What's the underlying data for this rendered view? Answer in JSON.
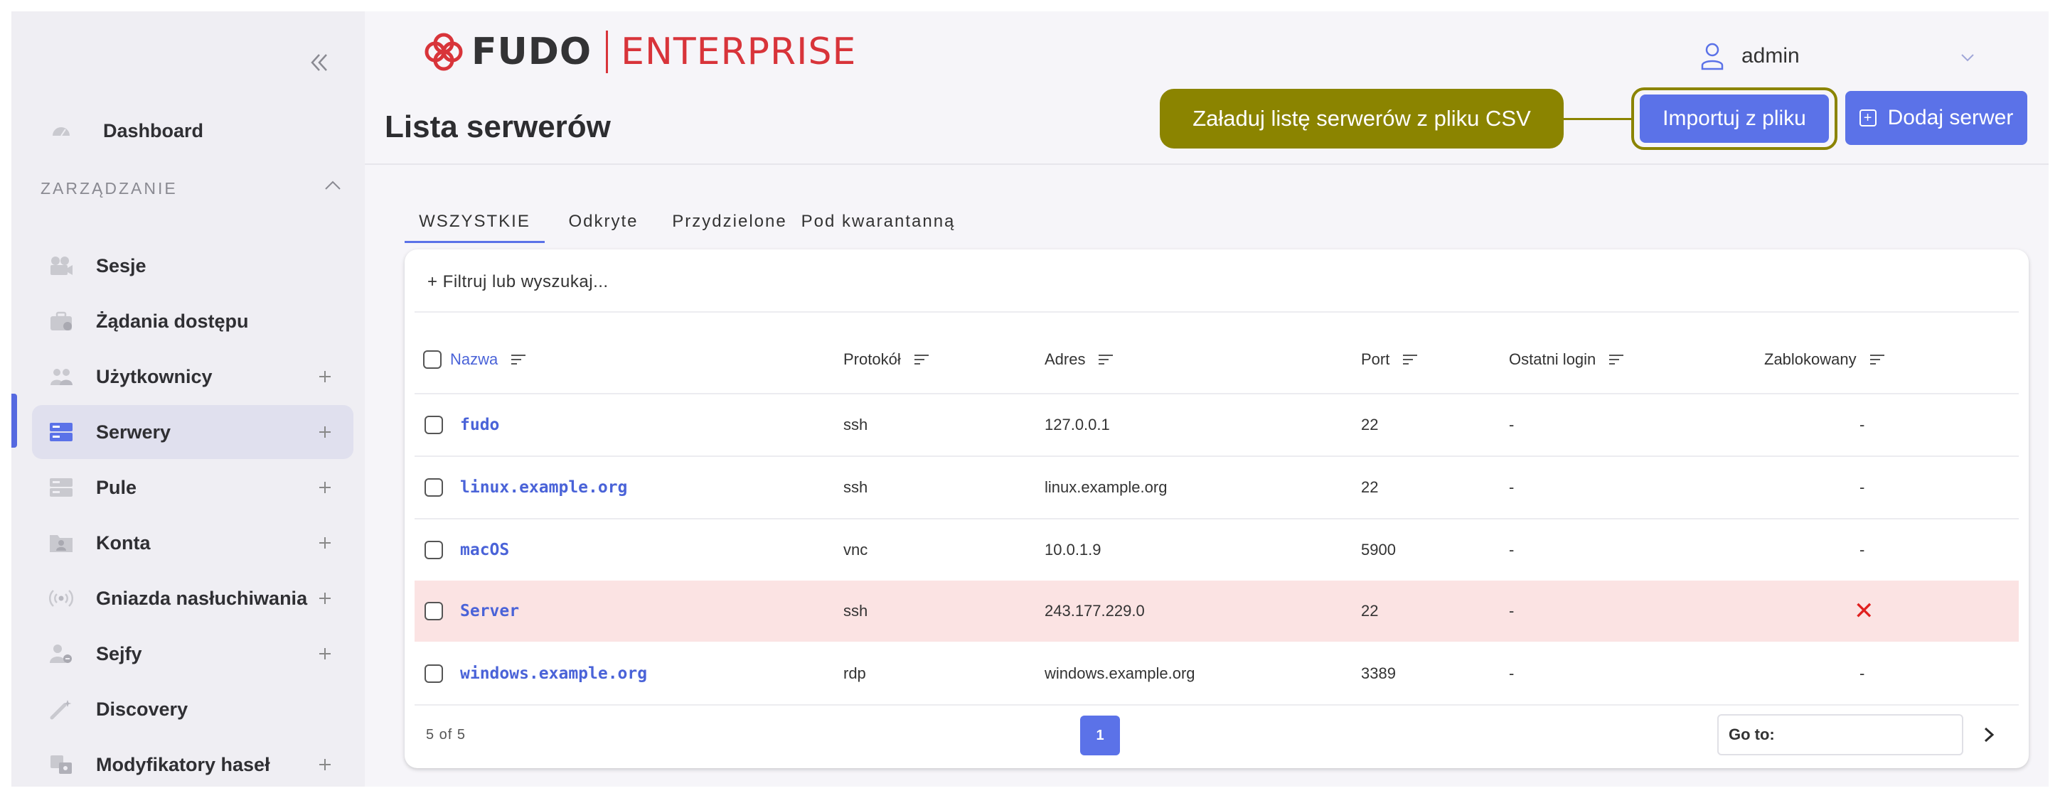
{
  "sidebar": {
    "collapse_icon": "double-chevron-left-icon",
    "dashboard": "Dashboard",
    "section_label": "ZARZĄDZANIE",
    "items": [
      {
        "label": "Sesje",
        "icon": "camera-icon",
        "has_plus": false
      },
      {
        "label": "Żądania dostępu",
        "icon": "briefcase-icon",
        "has_plus": false
      },
      {
        "label": "Użytkownicy",
        "icon": "users-icon",
        "has_plus": true
      },
      {
        "label": "Serwery",
        "icon": "server-icon",
        "has_plus": true,
        "active": true
      },
      {
        "label": "Pule",
        "icon": "pool-icon",
        "has_plus": true
      },
      {
        "label": "Konta",
        "icon": "account-folder-icon",
        "has_plus": true
      },
      {
        "label": "Gniazda nasłuchiwania",
        "icon": "broadcast-icon",
        "has_plus": true
      },
      {
        "label": "Sejfy",
        "icon": "safe-user-icon",
        "has_plus": true
      },
      {
        "label": "Discovery",
        "icon": "wand-icon",
        "has_plus": false
      },
      {
        "label": "Modyfikatory haseł",
        "icon": "password-modifier-icon",
        "has_plus": true
      }
    ]
  },
  "header": {
    "logo_fudo": "FUDO",
    "logo_enterprise": "ENTERPRISE",
    "user_name": "admin",
    "page_title": "Lista serwerów",
    "tooltip": "Załaduj listę serwerów z pliku CSV",
    "import_button": "Importuj z pliku",
    "add_button": "Dodaj serwer"
  },
  "tabs": [
    "WSZYSTKIE",
    "Odkryte",
    "Przydzielone",
    "Pod kwarantanną"
  ],
  "table": {
    "filter_placeholder": "+ Filtruj lub wyszukaj...",
    "columns": [
      "Nazwa",
      "Protokół",
      "Adres",
      "Port",
      "Ostatni login",
      "Zablokowany"
    ],
    "rows": [
      {
        "name": "fudo",
        "protocol": "ssh",
        "address": "127.0.0.1",
        "port": "22",
        "last_login": "-",
        "blocked": "-"
      },
      {
        "name": "linux.example.org",
        "protocol": "ssh",
        "address": "linux.example.org",
        "port": "22",
        "last_login": "-",
        "blocked": "-"
      },
      {
        "name": "macOS",
        "protocol": "vnc",
        "address": "10.0.1.9",
        "port": "5900",
        "last_login": "-",
        "blocked": "-"
      },
      {
        "name": "Server",
        "protocol": "ssh",
        "address": "243.177.229.0",
        "port": "22",
        "last_login": "-",
        "blocked": "✕"
      },
      {
        "name": "windows.example.org",
        "protocol": "rdp",
        "address": "windows.example.org",
        "port": "3389",
        "last_login": "-",
        "blocked": "-"
      }
    ],
    "count": "5 of 5",
    "current_page": "1",
    "goto_label": "Go to:"
  },
  "colors": {
    "accent": "#5b72e8",
    "tooltip": "#8b8400",
    "blocked_row": "#fbe3e3",
    "blocked_mark": "#e0201f",
    "brand_red": "#d8343a"
  }
}
